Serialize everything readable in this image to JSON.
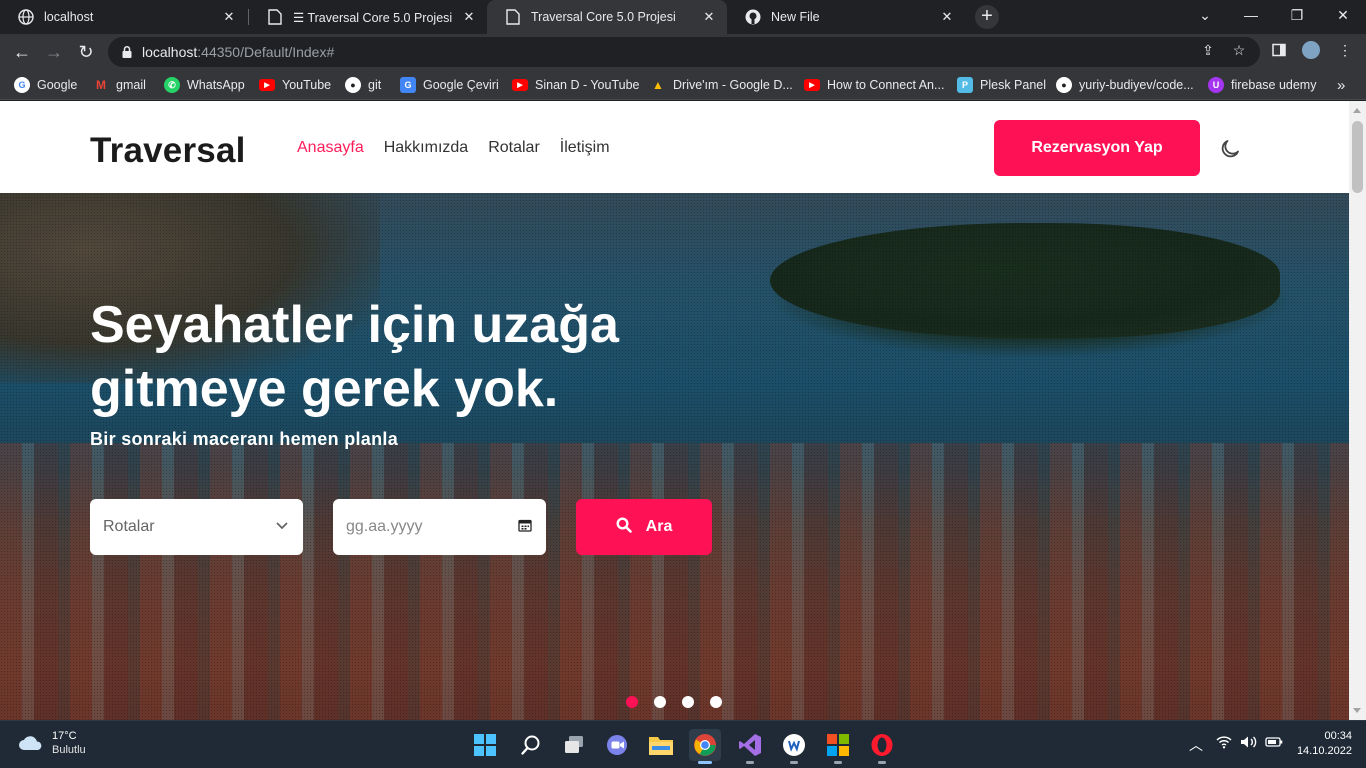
{
  "browser": {
    "tabs": [
      {
        "title": "localhost",
        "icon": "globe-icon"
      },
      {
        "title": "☰ Traversal Core 5.0 Projesi",
        "icon": "document-icon"
      },
      {
        "title": "Traversal Core 5.0 Projesi",
        "icon": "document-icon"
      },
      {
        "title": "New File",
        "icon": "github-icon"
      }
    ],
    "active_tab": 2,
    "url_host": "localhost",
    "url_rest": ":44350/Default/Index#",
    "bookmarks": [
      {
        "label": "Google",
        "color": "#ffffff",
        "glyph": "G"
      },
      {
        "label": "gmail",
        "color": "#ea4335",
        "glyph": "M"
      },
      {
        "label": "WhatsApp",
        "color": "#25d366",
        "glyph": "W"
      },
      {
        "label": "YouTube",
        "color": "#ff0000",
        "glyph": "▶"
      },
      {
        "label": "git",
        "color": "#ffffff",
        "glyph": "●"
      },
      {
        "label": "Google Çeviri",
        "color": "#4285f4",
        "glyph": "G"
      },
      {
        "label": "Sinan D - YouTube",
        "color": "#ff0000",
        "glyph": "▶"
      },
      {
        "label": "Drive'ım - Google D...",
        "color": "#fbbc04",
        "glyph": "▲"
      },
      {
        "label": "How to Connect An...",
        "color": "#ff0000",
        "glyph": "▶"
      },
      {
        "label": "Plesk Panel",
        "color": "#53bce6",
        "glyph": "P"
      },
      {
        "label": "yuriy-budiyev/code...",
        "color": "#ffffff",
        "glyph": "●"
      },
      {
        "label": "firebase udemy",
        "color": "#a435f0",
        "glyph": "U"
      }
    ],
    "bookmarks_overflow": "»"
  },
  "site": {
    "logo": "Traversal",
    "nav": [
      {
        "label": "Anasayfa",
        "active": true
      },
      {
        "label": "Hakkımızda",
        "active": false
      },
      {
        "label": "Rotalar",
        "active": false
      },
      {
        "label": "İletişim",
        "active": false
      }
    ],
    "cta_label": "Rezervasyon Yap",
    "accent": "#ff1156",
    "hero": {
      "title_line1": "Seyahatler için uzağa",
      "title_line2": "gitmeye gerek yok.",
      "subtitle": "Bir sonraki maceranı hemen planla",
      "route_select": "Rotalar",
      "date_placeholder": "gg.aa.yyyy",
      "search_label": "Ara",
      "slides": 4,
      "active_slide": 0
    }
  },
  "taskbar": {
    "temperature": "17°C",
    "condition": "Bulutlu",
    "time": "00:34",
    "date": "14.10.2022",
    "apps": [
      "windows-start-icon",
      "search-icon",
      "task-view-icon",
      "teams-chat-icon",
      "file-explorer-icon",
      "chrome-icon",
      "visual-studio-icon",
      "word-icon",
      "snip-icon",
      "opera-icon"
    ]
  }
}
